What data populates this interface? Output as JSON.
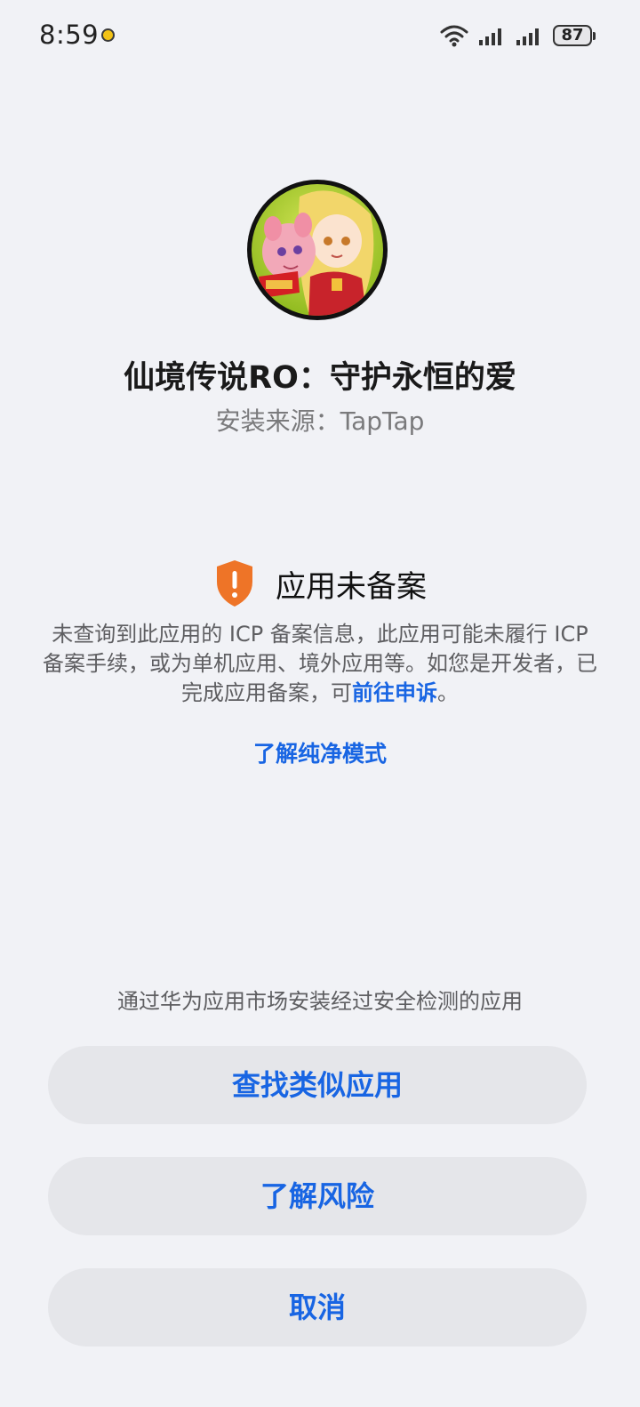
{
  "status_bar": {
    "time": "8:59",
    "battery_level": "87",
    "icons": [
      "notification-dot-icon",
      "wifi-icon",
      "signal-icon",
      "signal-icon",
      "battery-icon"
    ]
  },
  "app": {
    "name": "仙境传说RO：守护永恒的爱",
    "install_source": "安装来源：TapTap",
    "icon": "app-icon"
  },
  "warning": {
    "icon": "shield-alert-icon",
    "title": "应用未备案",
    "description_part1": "未查询到此应用的 ICP 备案信息，此应用可能未履行 ICP 备案手续，或为单机应用、境外应用等。如您是开发者，已完成应用备案，可",
    "appeal_link": "前往申诉",
    "description_end": "。",
    "pure_mode_link": "了解纯净模式"
  },
  "bottom": {
    "hint": "通过华为应用市场安装经过安全检测的应用",
    "find_similar_label": "查找类似应用",
    "learn_risk_label": "了解风险",
    "cancel_label": "取消"
  },
  "colors": {
    "background": "#f1f2f6",
    "accent": "#1865e3",
    "warning": "#ee7427",
    "button_bg": "#e5e6ea"
  }
}
